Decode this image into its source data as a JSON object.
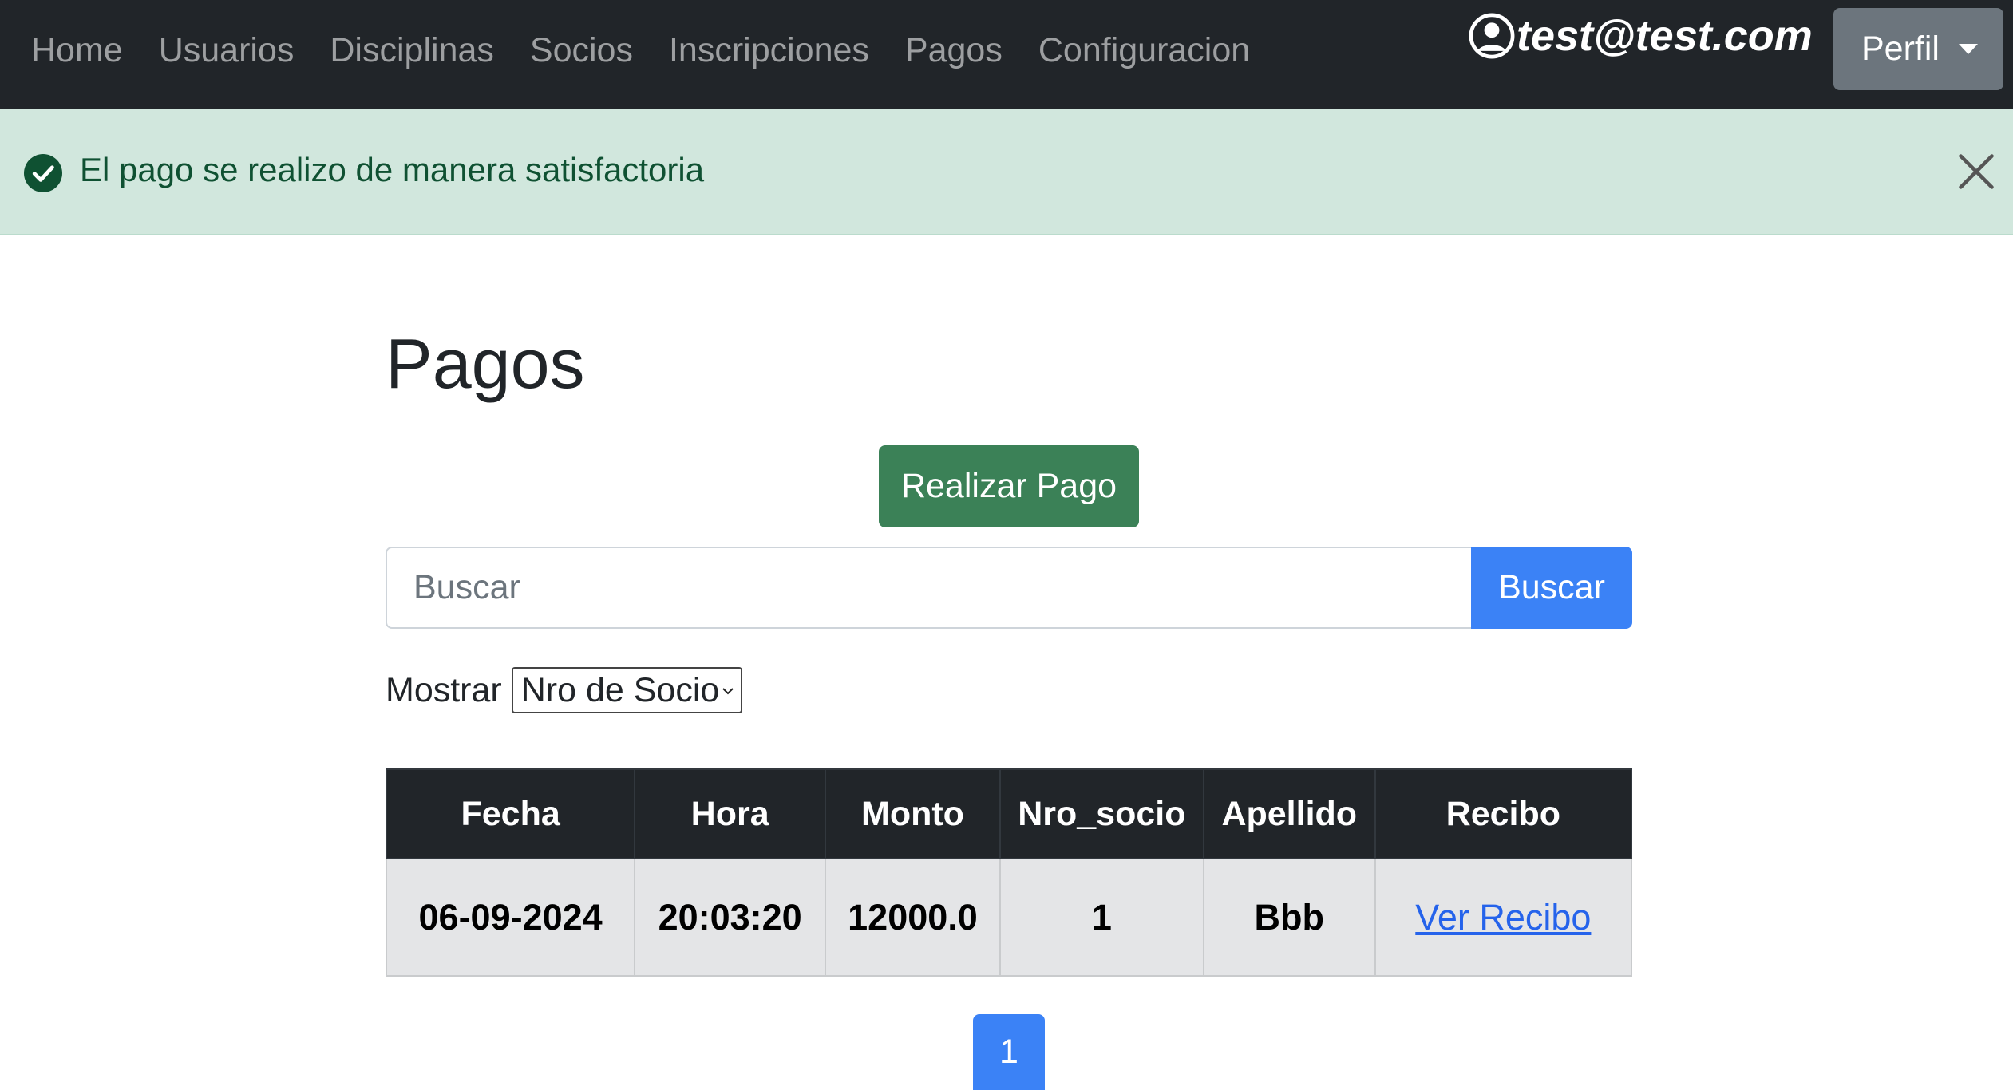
{
  "navbar": {
    "links": [
      "Home",
      "Usuarios",
      "Disciplinas",
      "Socios",
      "Inscripciones",
      "Pagos",
      "Configuracion"
    ],
    "user_email": "test@test.com",
    "profile_label": "Perfil"
  },
  "alert": {
    "message": "El pago se realizo de manera satisfactoria"
  },
  "main": {
    "title": "Pagos",
    "pay_button": "Realizar Pago",
    "search": {
      "placeholder": "Buscar",
      "value": "",
      "button": "Buscar"
    },
    "show": {
      "label": "Mostrar",
      "selected": "Nro de Socio"
    }
  },
  "table": {
    "headers": [
      "Fecha",
      "Hora",
      "Monto",
      "Nro_socio",
      "Apellido",
      "Recibo"
    ],
    "rows": [
      {
        "fecha": "06-09-2024",
        "hora": "20:03:20",
        "monto": "12000.0",
        "nro_socio": "1",
        "apellido": "Bbb",
        "recibo": "Ver Recibo"
      }
    ]
  },
  "pagination": {
    "current": "1"
  },
  "colors": {
    "navbar_bg": "#212529",
    "alert_bg": "#d1e7dd",
    "alert_text": "#0f5132",
    "success_button": "#3b8157",
    "primary": "#3b82f6",
    "profile_button": "#6c757d"
  },
  "icons": {
    "user": "person-circle-icon",
    "alert_status": "check-circle-icon",
    "close": "close-icon",
    "profile_caret": "caret-down-icon",
    "select_chevron": "chevron-down-icon"
  }
}
